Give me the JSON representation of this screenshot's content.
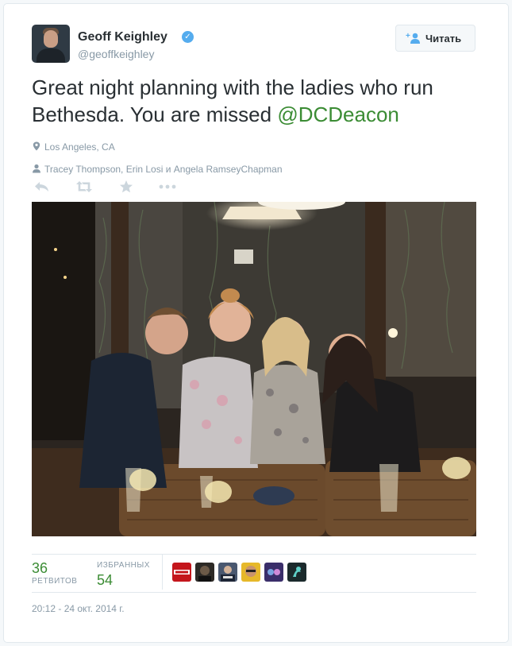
{
  "user": {
    "name": "Geoff Keighley",
    "handle": "@geoffkeighley",
    "verified": true
  },
  "follow_button": {
    "label": "Читать",
    "icon": "add-user-icon"
  },
  "tweet": {
    "text": "Great night planning with the ladies who run Bethesda. You are missed ",
    "mention": "@DCDeacon",
    "location": "Los Angeles, CA",
    "tagged": "Tracey Thompson, Erin Losi и Angela RamseyChapman"
  },
  "actions": [
    {
      "name": "reply-icon"
    },
    {
      "name": "retweet-icon"
    },
    {
      "name": "favorite-icon"
    },
    {
      "name": "more-icon"
    }
  ],
  "stats": {
    "retweets": {
      "count": "36",
      "label": "РЕТВИТОВ"
    },
    "favorites": {
      "count": "54",
      "label": "ИЗБРАННЫХ"
    }
  },
  "timestamp": "20:12 - 24 окт. 2014 г.",
  "colors": {
    "accent_green": "#3b8c34",
    "verified_blue": "#55acee",
    "muted": "#8899a6"
  }
}
